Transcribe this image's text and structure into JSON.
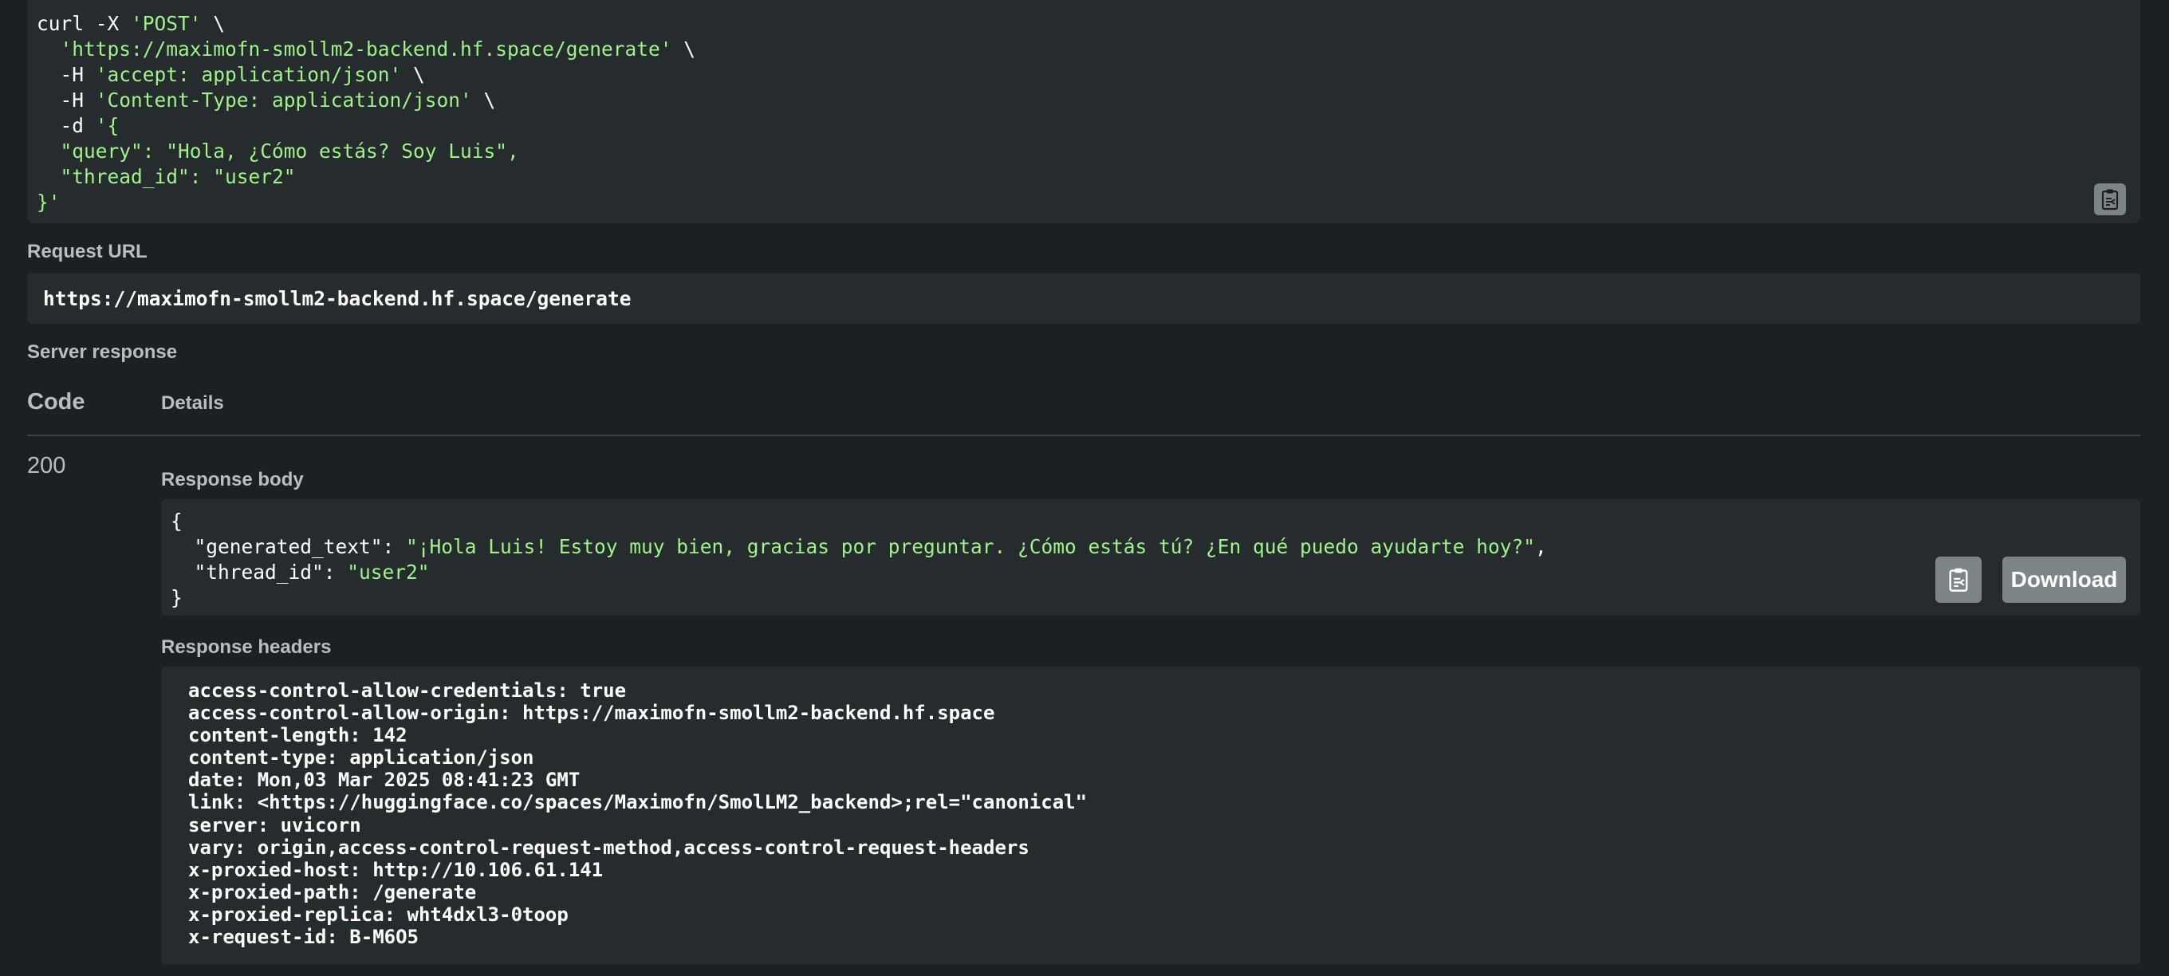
{
  "curl": {
    "lines": [
      [
        {
          "t": "curl -X ",
          "c": "w"
        },
        {
          "t": "'POST'",
          "c": "g"
        },
        {
          "t": " \\",
          "c": "w"
        }
      ],
      [
        {
          "t": "  ",
          "c": "w"
        },
        {
          "t": "'https://maximofn-smollm2-backend.hf.space/generate'",
          "c": "g"
        },
        {
          "t": " \\",
          "c": "w"
        }
      ],
      [
        {
          "t": "  -H ",
          "c": "w"
        },
        {
          "t": "'accept: application/json'",
          "c": "g"
        },
        {
          "t": " \\",
          "c": "w"
        }
      ],
      [
        {
          "t": "  -H ",
          "c": "w"
        },
        {
          "t": "'Content-Type: application/json'",
          "c": "g"
        },
        {
          "t": " \\",
          "c": "w"
        }
      ],
      [
        {
          "t": "  -d ",
          "c": "w"
        },
        {
          "t": "'{",
          "c": "g"
        }
      ],
      [
        {
          "t": "  \"query\": \"Hola, ¿Cómo estás? Soy Luis\",",
          "c": "g"
        }
      ],
      [
        {
          "t": "  \"thread_id\": \"user2\"",
          "c": "g"
        }
      ],
      [
        {
          "t": "}'",
          "c": "g"
        }
      ]
    ]
  },
  "request_url": {
    "label": "Request URL",
    "value": "https://maximofn-smollm2-backend.hf.space/generate"
  },
  "server_response": {
    "label": "Server response",
    "code_header": "Code",
    "details_header": "Details",
    "code": "200",
    "body_label": "Response body",
    "body_lines": [
      [
        {
          "t": "{",
          "c": "w"
        }
      ],
      [
        {
          "t": "  \"generated_text\": ",
          "c": "w"
        },
        {
          "t": "\"¡Hola Luis! Estoy muy bien, gracias por preguntar. ¿Cómo estás tú? ¿En qué puedo ayudarte hoy?\"",
          "c": "g"
        },
        {
          "t": ",",
          "c": "w"
        }
      ],
      [
        {
          "t": "  \"thread_id\": ",
          "c": "w"
        },
        {
          "t": "\"user2\"",
          "c": "g"
        }
      ],
      [
        {
          "t": "}",
          "c": "w"
        }
      ]
    ],
    "download_label": "Download",
    "headers_label": "Response headers",
    "headers": [
      "access-control-allow-credentials: true",
      "access-control-allow-origin: https://maximofn-smollm2-backend.hf.space",
      "content-length: 142",
      "content-type: application/json",
      "date: Mon,03 Mar 2025 08:41:23 GMT",
      "link: <https://huggingface.co/spaces/Maximofn/SmolLM2_backend>;rel=\"canonical\"",
      "server: uvicorn",
      "vary: origin,access-control-request-method,access-control-request-headers",
      "x-proxied-host: http://10.106.61.141",
      "x-proxied-path: /generate",
      "x-proxied-replica: wht4dxl3-0toop",
      "x-request-id: B-M6O5"
    ]
  },
  "icons": {
    "copy": "clipboard-copy-icon"
  }
}
